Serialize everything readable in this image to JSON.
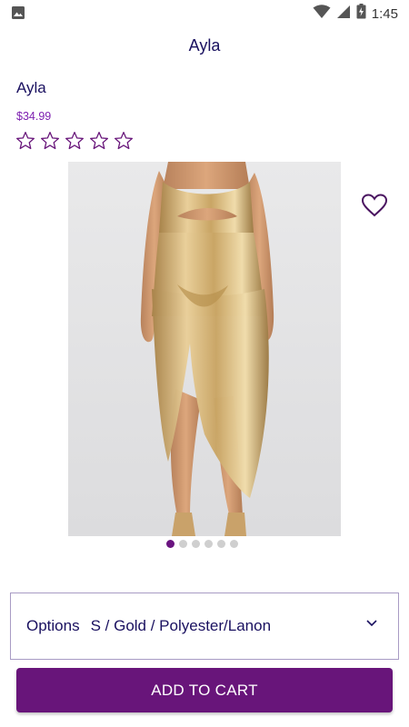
{
  "status_bar": {
    "time": "1:45",
    "icons": [
      "image-icon",
      "wifi-icon",
      "signal-icon",
      "battery-charging-icon"
    ]
  },
  "header": {
    "title": "Ayla"
  },
  "product": {
    "name": "Ayla",
    "price": "$34.99",
    "rating": 0,
    "rating_max": 5,
    "image_count": 6,
    "active_image_index": 0
  },
  "options": {
    "label": "Options",
    "selected_value": "S / Gold / Polyester/Lanon"
  },
  "actions": {
    "add_to_cart_label": "ADD TO CART"
  },
  "colors": {
    "accent": "#68157a",
    "price": "#7d1fb0",
    "text": "#1a1160",
    "dot_inactive": "#cfcfcf"
  }
}
